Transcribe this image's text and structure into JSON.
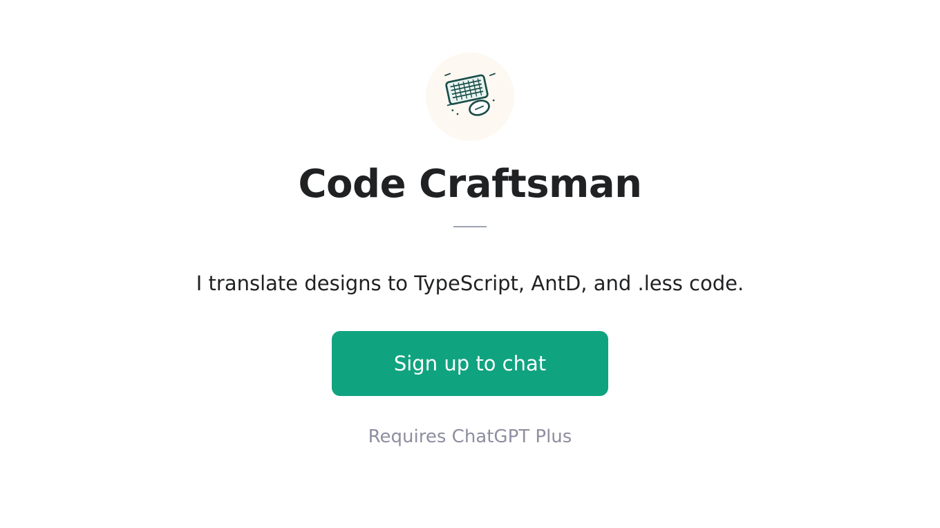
{
  "title": "Code Craftsman",
  "description": "I translate designs to TypeScript, AntD, and .less code.",
  "signup_button": "Sign up to chat",
  "requires_text": "Requires ChatGPT Plus",
  "icon_name": "keyboard-mouse-icon",
  "colors": {
    "accent": "#10a37f",
    "logo_bg": "#fdf8f1",
    "text_primary": "#202123",
    "text_secondary": "#8e8ea0"
  }
}
